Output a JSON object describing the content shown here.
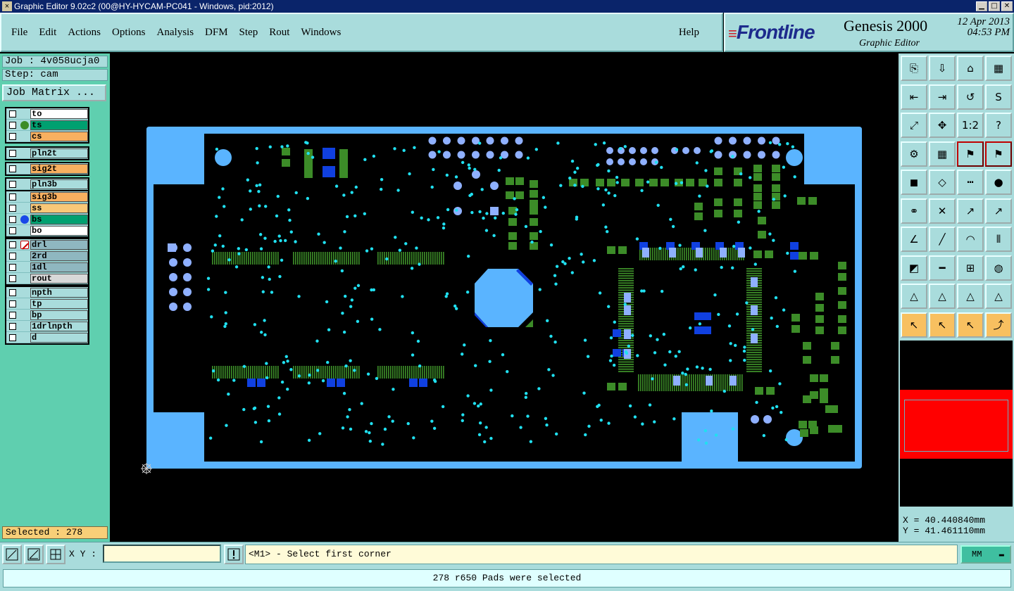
{
  "window": {
    "title": "Graphic Editor 9.02c2 (00@HY-HYCAM-PC041 - Windows, pid:2012)"
  },
  "menu": {
    "items": [
      "File",
      "Edit",
      "Actions",
      "Options",
      "Analysis",
      "DFM",
      "Step",
      "Rout",
      "Windows"
    ],
    "help": "Help"
  },
  "brand": {
    "logo": "Frontline",
    "product": "Genesis 2000",
    "subtitle": "Graphic Editor",
    "date": "12 Apr 2013",
    "time": "04:53 PM"
  },
  "job": {
    "job_label": "Job : 4v058ucja0",
    "step_label": "Step: cam",
    "matrix_button": "Job Matrix ..."
  },
  "layers": {
    "group1": [
      {
        "name": "to",
        "color": "#ffffff"
      },
      {
        "name": "ts",
        "color": "#00a070",
        "dot": "#3c8c28"
      },
      {
        "name": "cs",
        "color": "#f8b060"
      }
    ],
    "group2": [
      {
        "name": "pln2t",
        "color": "#a9dcdc"
      }
    ],
    "group3": [
      {
        "name": "sig2t",
        "color": "#f8b060"
      }
    ],
    "group4": [
      {
        "name": "pln3b",
        "color": "#a9dcdc"
      }
    ],
    "group5": [
      {
        "name": "sig3b",
        "color": "#f8b060"
      },
      {
        "name": "ss",
        "color": "#f8c878"
      },
      {
        "name": "bs",
        "color": "#00a070",
        "dot": "#1848e8"
      },
      {
        "name": "bo",
        "color": "#ffffff"
      }
    ],
    "group6": [
      {
        "name": "drl",
        "color": "#8fb7c0"
      },
      {
        "name": "2rd",
        "color": "#8fb7c0"
      },
      {
        "name": "1dl",
        "color": "#8fb7c0"
      },
      {
        "name": "rout",
        "color": "#d8d8d8"
      }
    ],
    "group7": [
      {
        "name": "npth",
        "color": "#a9dcdc"
      },
      {
        "name": "tp",
        "color": "#a9dcdc"
      },
      {
        "name": "bp",
        "color": "#a9dcdc"
      },
      {
        "name": "1drlnpth",
        "color": "#a9dcdc"
      },
      {
        "name": "d",
        "color": "#a9dcdc"
      }
    ]
  },
  "selection": {
    "label": "Selected : 278"
  },
  "coords": {
    "x_label": "X = 40.440840mm",
    "y_label": "Y = 41.461110mm"
  },
  "command": {
    "xy_label": "X Y :",
    "xy_value": "",
    "prompt": "<M1> - Select first corner",
    "units": "MM"
  },
  "status": {
    "message": "278 r650 Pads were selected"
  },
  "colors": {
    "board": "#5ab4ff",
    "pad_green": "#3c8c28",
    "pad_blue": "#1040e0",
    "via": "#20e0f0",
    "panel": "#a9dcdc",
    "selected_bg": "#f8cf78"
  }
}
